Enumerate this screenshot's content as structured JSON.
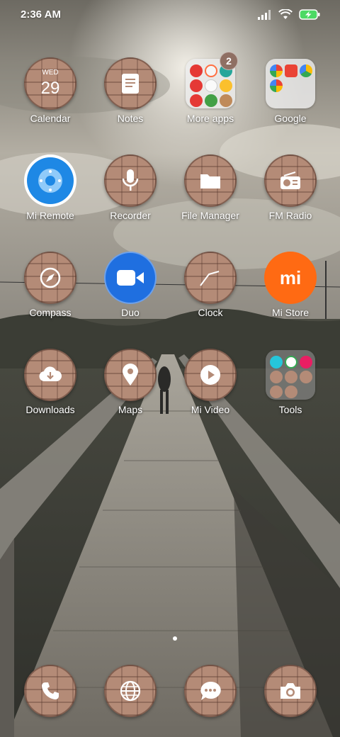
{
  "status_bar": {
    "time": "2:36 AM"
  },
  "apps": [
    {
      "label": "Calendar",
      "icon": "calendar-icon",
      "day": "WED",
      "date": "29"
    },
    {
      "label": "Notes",
      "icon": "notes-icon"
    },
    {
      "label": "More apps",
      "icon": "folder-icon",
      "badge": "2"
    },
    {
      "label": "Google",
      "icon": "folder-icon"
    },
    {
      "label": "Mi Remote",
      "icon": "remote-icon"
    },
    {
      "label": "Recorder",
      "icon": "microphone-icon"
    },
    {
      "label": "File Manager",
      "icon": "folder-file-icon"
    },
    {
      "label": "FM Radio",
      "icon": "radio-icon"
    },
    {
      "label": "Compass",
      "icon": "compass-icon"
    },
    {
      "label": "Duo",
      "icon": "video-camera-icon"
    },
    {
      "label": "Clock",
      "icon": "clock-icon"
    },
    {
      "label": "Mi Store",
      "icon": "mi-logo-icon",
      "logo_text": "mi"
    },
    {
      "label": "Downloads",
      "icon": "cloud-download-icon"
    },
    {
      "label": "Maps",
      "icon": "map-pin-icon"
    },
    {
      "label": "Mi Video",
      "icon": "play-icon"
    },
    {
      "label": "Tools",
      "icon": "folder-icon"
    }
  ],
  "dock": [
    {
      "name": "phone",
      "icon": "phone-icon"
    },
    {
      "name": "browser",
      "icon": "globe-icon"
    },
    {
      "name": "messages",
      "icon": "chat-icon"
    },
    {
      "name": "camera",
      "icon": "camera-icon"
    }
  ],
  "colors": {
    "mi_store_orange": "#ff6a13",
    "duo_blue": "#1f6fe0",
    "remote_blue": "#1e88e5",
    "badge": "#8f6f63"
  }
}
